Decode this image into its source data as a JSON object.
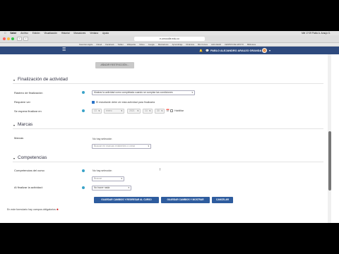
{
  "macmenu": {
    "items": [
      "Safari",
      "Archivo",
      "Edición",
      "Visualización",
      "Historial",
      "Marcadores",
      "Ventana",
      "Ayuda"
    ],
    "clock": "Mié 17:09  Pablo A. Araujo G."
  },
  "browser": {
    "url": "e-umoodle.edu.co"
  },
  "bookmarks": [
    "Favoritos Apple",
    "iCloud",
    "Facebook",
    "Twitter",
    "Wikipedia",
    "Yahoo",
    "Google",
    "Marcadores",
    "Aprendizaje",
    "Dinámica",
    "Mis Cursos",
    "AVA-CEAD",
    "CENTRO DE APOYO",
    "Biblioteca"
  ],
  "navbar": {
    "username": "PABLO ALEJANDRO ARAUJO GRANDA",
    "accent": "#2e4a7e"
  },
  "top_button": "AÑADIR RESTRICCIÓN...",
  "sections": {
    "activity_completion": {
      "title": "Finalización de actividad",
      "tracking_label": "Rastreo de finalización",
      "tracking_value": "Mostrar la actividad como completada cuando se cumplan las condiciones",
      "require_view_label": "Requiere ver",
      "require_view_text": "El estudiante debe ver esta actividad para finalizarla",
      "expected_label": "Se espera finalizar en",
      "date": {
        "day": "13",
        "month": "enero",
        "year": "2021",
        "hour": "14",
        "minute": "30"
      },
      "enable_label": "Habilitar"
    },
    "tags": {
      "title": "Marcas",
      "label": "Marcas",
      "no_selection": "No hay selección",
      "input_placeholder": "Buscar en marcas existentes o crear"
    },
    "competencies": {
      "title": "Competencias",
      "course_comp_label": "Competencias del curso",
      "no_selection": "No hay selección",
      "search_placeholder": "Buscar",
      "on_completion_label": "Al finalizar la actividad:",
      "on_completion_value": "No hacer nada"
    }
  },
  "actions": {
    "save_return": "GUARDAR CAMBIOS Y REGRESAR AL CURSO",
    "save_show": "GUARDAR CAMBIOS Y MOSTRAR",
    "cancel": "CANCELAR"
  },
  "required_note": "En este formulario hay campos obligatorios"
}
